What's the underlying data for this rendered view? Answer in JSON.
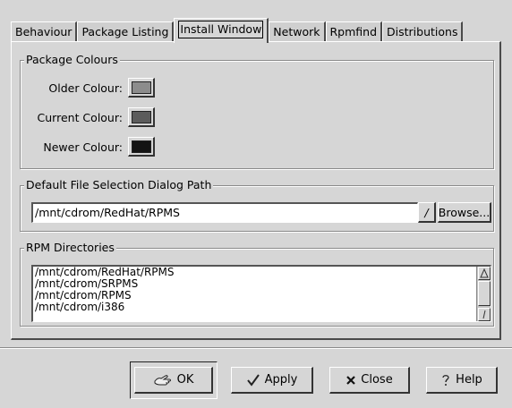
{
  "tabs": [
    {
      "label": "Behaviour"
    },
    {
      "label": "Package Listing"
    },
    {
      "label": "Install Window"
    },
    {
      "label": "Network"
    },
    {
      "label": "Rpmfind"
    },
    {
      "label": "Distributions"
    }
  ],
  "package_colours": {
    "title": "Package Colours",
    "older_label": "Older Colour:",
    "older_color": "#8c8c8c",
    "current_label": "Current Colour:",
    "current_color": "#5c5c5c",
    "newer_label": "Newer Colour:",
    "newer_color": "#141414"
  },
  "file_dialog": {
    "title": "Default File Selection Dialog Path",
    "path_value": "/mnt/cdrom/RedHat/RPMS",
    "slash_label": "/",
    "browse_label": "Browse..."
  },
  "rpm_dirs": {
    "title": "RPM Directories",
    "items": [
      "/mnt/cdrom/RedHat/RPMS",
      "/mnt/cdrom/SRPMS",
      "/mnt/cdrom/RPMS",
      "/mnt/cdrom/i386"
    ]
  },
  "buttons": {
    "ok": "OK",
    "apply": "Apply",
    "close": "Close",
    "help": "Help"
  }
}
